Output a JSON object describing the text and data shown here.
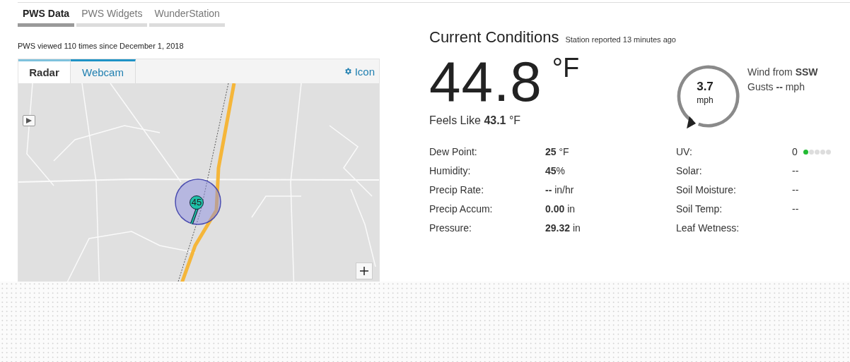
{
  "tabs": [
    {
      "label": "PWS Data",
      "selected": true
    },
    {
      "label": "PWS Widgets",
      "selected": false
    },
    {
      "label": "WunderStation",
      "selected": false
    }
  ],
  "view_count": "PWS viewed 110 times since December 1, 2018",
  "media_panel": {
    "tabs": [
      {
        "label": "Radar",
        "selected": true
      },
      {
        "label": "Webcam",
        "selected": false
      }
    ],
    "icon_link": "Icon",
    "map": {
      "kind": "picture",
      "marker": "45"
    }
  },
  "current_conditions": {
    "title": "Current Conditions",
    "reported": "Station reported 13 minutes ago",
    "temperature": "44.8",
    "temperature_unit": "°F",
    "feels_like": "Feels Like **43.1** °F",
    "wind": {
      "speed": "3.7",
      "unit": "mph",
      "direction": "Wind from **SSW**",
      "gusts": "Gusts **--** mph"
    },
    "readings_left": [
      {
        "label": "Dew Point:",
        "value": "**25** °F"
      },
      {
        "label": "Humidity:",
        "value": "**45**%"
      },
      {
        "label": "Precip Rate:",
        "value": "**--** in/hr"
      },
      {
        "label": "Precip Accum:",
        "value": "**0.00** in"
      },
      {
        "label": "Pressure:",
        "value": "**29.32** in"
      }
    ],
    "readings_right": [
      {
        "label": "UV:",
        "value": "0",
        "kind": "meter",
        "level": 0.2
      },
      {
        "label": "Solar:",
        "value": "--",
        "kind": "text"
      },
      {
        "label": "Soil Moisture:",
        "value": "--",
        "kind": "text"
      },
      {
        "label": "Soil Temp:",
        "value": "--",
        "kind": "text"
      },
      {
        "label": "Leaf Wetness:",
        "kind": "text"
      }
    ]
  }
}
